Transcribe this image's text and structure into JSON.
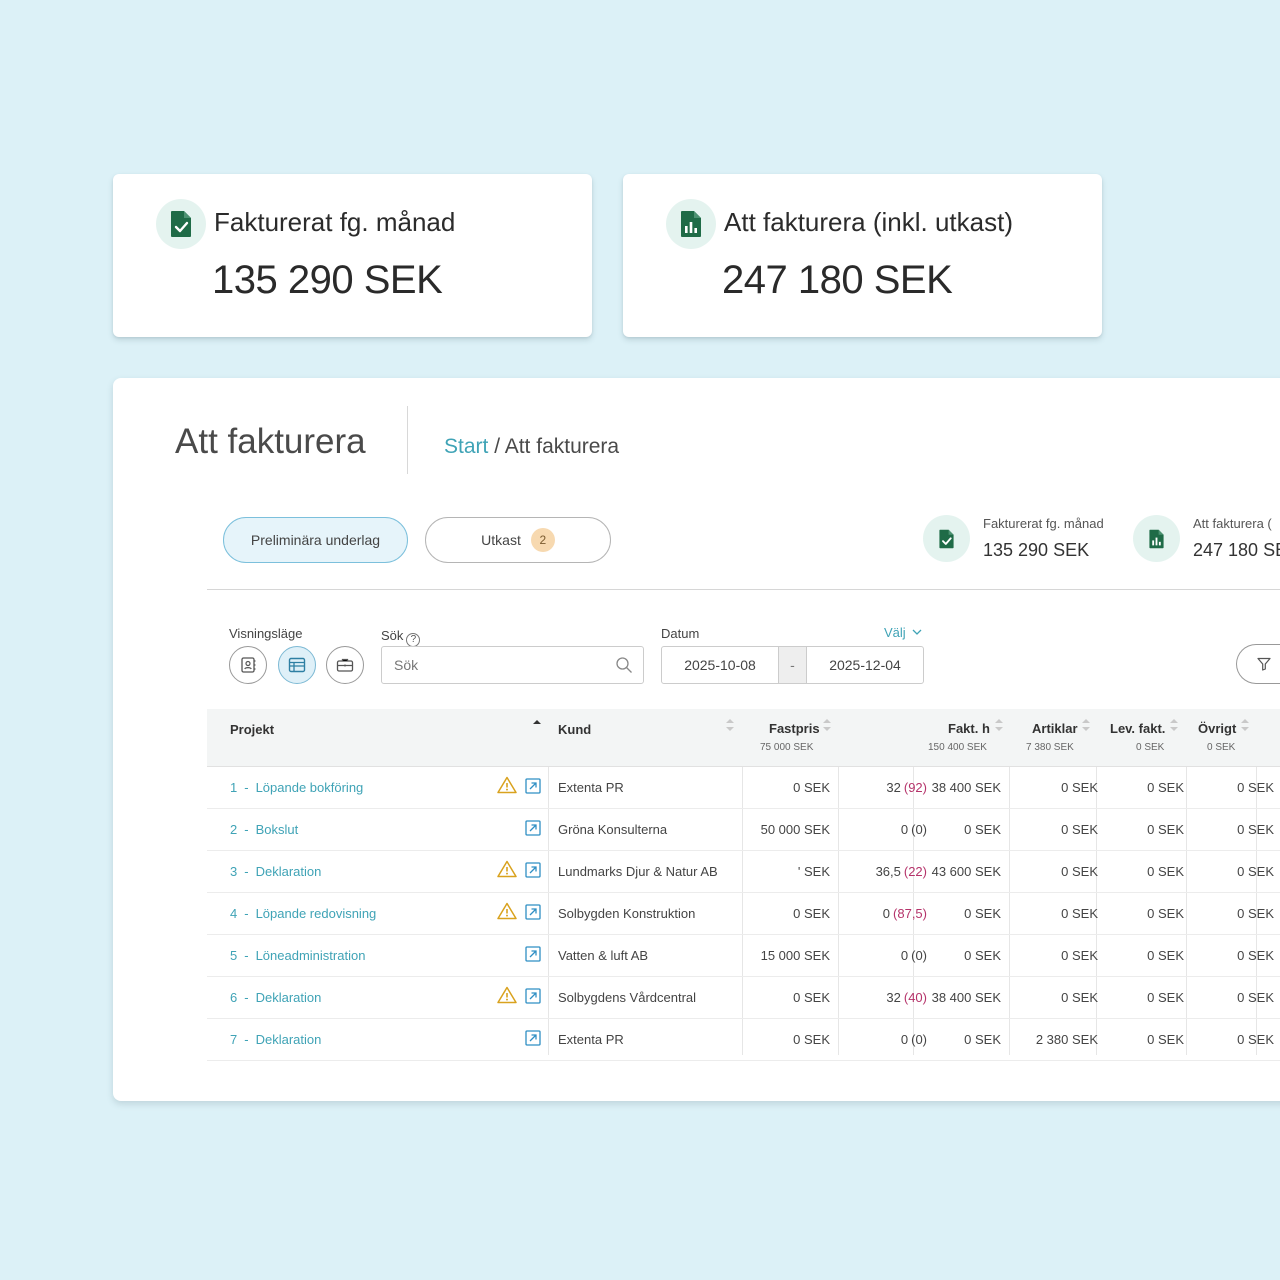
{
  "top_cards": [
    {
      "label": "Fakturerat fg. månad",
      "value": "135 290 SEK",
      "icon": "invoice-check-icon"
    },
    {
      "label": "Att fakturera (inkl. utkast)",
      "value": "247 180 SEK",
      "icon": "invoice-chart-icon"
    }
  ],
  "page": {
    "title": "Att fakturera",
    "breadcrumb": {
      "link": "Start",
      "separator": " / ",
      "current": "Att fakturera"
    }
  },
  "tabs": [
    {
      "label": "Preliminära underlag",
      "active": true
    },
    {
      "label": "Utkast",
      "badge": "2",
      "active": false
    }
  ],
  "mini_stats": [
    {
      "label": "Fakturerat fg. månad",
      "value": "135 290 SEK",
      "icon": "invoice-check-icon"
    },
    {
      "label": "Att fakturera (",
      "value": "247 180 SE",
      "icon": "invoice-chart-icon"
    }
  ],
  "filters": {
    "view_label": "Visningsläge",
    "search_label": "Sök",
    "search_help": "?",
    "search_placeholder": "Sök",
    "date_label": "Datum",
    "choose_label": "Välj",
    "date_from": "2025-10-08",
    "date_sep": "-",
    "date_to": "2025-12-04"
  },
  "columns": [
    {
      "label": "Projekt",
      "sub": ""
    },
    {
      "label": "Kund",
      "sub": ""
    },
    {
      "label": "Fastpris",
      "sub": "75 000 SEK"
    },
    {
      "label": "",
      "sub": ""
    },
    {
      "label": "Fakt. h",
      "sub": "150 400 SEK"
    },
    {
      "label": "Artiklar",
      "sub": "7 380 SEK"
    },
    {
      "label": "Lev. fakt.",
      "sub": "0 SEK"
    },
    {
      "label": "Övrigt",
      "sub": "0 SEK"
    }
  ],
  "rows": [
    {
      "num": "1",
      "sep": "-",
      "name": "Löpande bokföring",
      "warn": true,
      "kund": "Extenta PR",
      "fastpris": "0 SEK",
      "hours": "32",
      "hours_paren": "(92)",
      "paren_red": true,
      "fakt_h": "38 400 SEK",
      "artiklar": "0 SEK",
      "lev": "0 SEK",
      "ovrigt": "0 SEK",
      "edge": "3"
    },
    {
      "num": "2",
      "sep": "-",
      "name": "Bokslut",
      "warn": false,
      "kund": "Gröna Konsulterna",
      "fastpris": "50 000 SEK",
      "hours": "0",
      "hours_paren": "(0)",
      "paren_red": false,
      "fakt_h": "0 SEK",
      "artiklar": "0 SEK",
      "lev": "0 SEK",
      "ovrigt": "0 SEK",
      "edge": "5"
    },
    {
      "num": "3",
      "sep": "-",
      "name": "Deklaration",
      "warn": true,
      "kund": "Lundmarks Djur & Natur AB",
      "fastpris": "' SEK",
      "hours": "36,5",
      "hours_paren": "(22)",
      "paren_red": true,
      "fakt_h": "43 600 SEK",
      "artiklar": "0 SEK",
      "lev": "0 SEK",
      "ovrigt": "0 SEK",
      "edge": "4"
    },
    {
      "num": "4",
      "sep": "-",
      "name": "Löpande redovisning",
      "warn": true,
      "kund": "Solbygden Konstruktion",
      "fastpris": "0 SEK",
      "hours": "0",
      "hours_paren": "(87,5)",
      "paren_red": true,
      "fakt_h": "0 SEK",
      "artiklar": "0 SEK",
      "lev": "0 SEK",
      "ovrigt": "0 SEK",
      "edge": ""
    },
    {
      "num": "5",
      "sep": "-",
      "name": "Löneadministration",
      "warn": false,
      "kund": "Vatten & luft AB",
      "fastpris": "15 000 SEK",
      "hours": "0",
      "hours_paren": "(0)",
      "paren_red": false,
      "fakt_h": "0 SEK",
      "artiklar": "0 SEK",
      "lev": "0 SEK",
      "ovrigt": "0 SEK",
      "edge": "1"
    },
    {
      "num": "6",
      "sep": "-",
      "name": "Deklaration",
      "warn": true,
      "kund": "Solbygdens Vårdcentral",
      "fastpris": "0 SEK",
      "hours": "32",
      "hours_paren": "(40)",
      "paren_red": true,
      "fakt_h": "38 400 SEK",
      "artiklar": "0 SEK",
      "lev": "0 SEK",
      "ovrigt": "0 SEK",
      "edge": "3"
    },
    {
      "num": "7",
      "sep": "-",
      "name": "Deklaration",
      "warn": false,
      "kund": "Extenta PR",
      "fastpris": "0 SEK",
      "hours": "0",
      "hours_paren": "(0)",
      "paren_red": false,
      "fakt_h": "0 SEK",
      "artiklar": "2 380 SEK",
      "lev": "0 SEK",
      "ovrigt": "0 SEK",
      "edge": ""
    }
  ],
  "colors": {
    "accent": "#3fa3b6",
    "icon_green": "#1f6b47",
    "warning": "#d9a21e",
    "negative": "#b5336a",
    "background": "#dcf1f7"
  }
}
